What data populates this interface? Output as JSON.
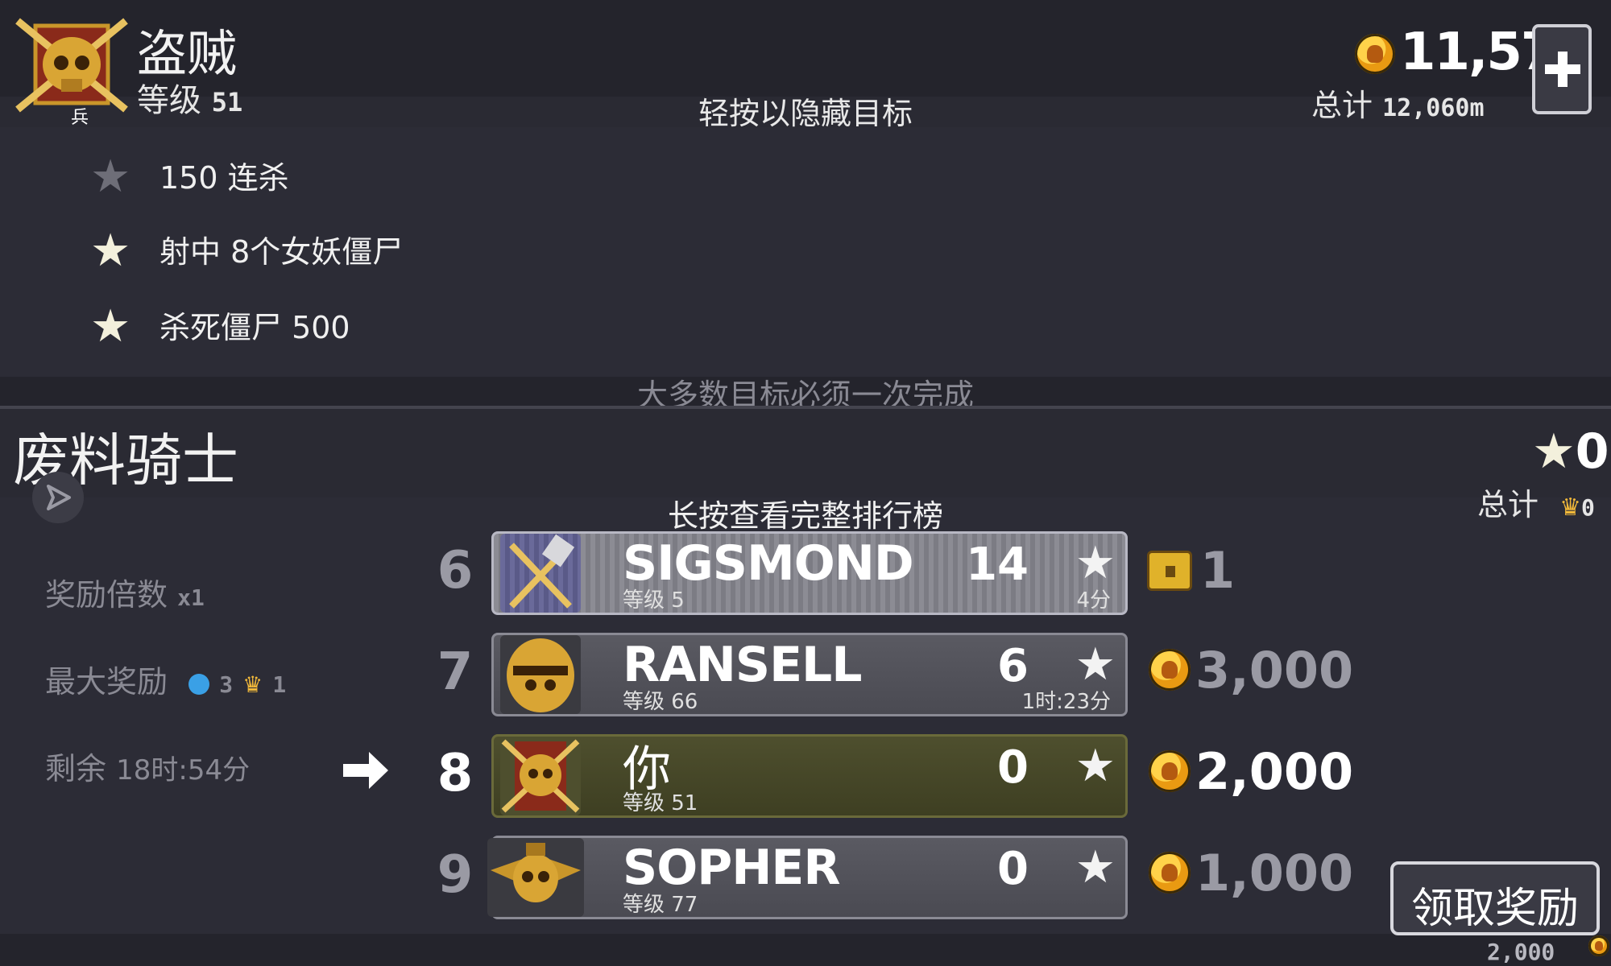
{
  "header": {
    "title": "盗贼",
    "level_label": "等级",
    "level_value": "51",
    "badge_text": "兵",
    "coins": "11,570",
    "total_label": "总计",
    "total_distance": "12,060m",
    "hint": "轻按以隐藏目标"
  },
  "goals": [
    {
      "text": "150 连杀",
      "done": false
    },
    {
      "text": "射中 8个女妖僵尸",
      "done": true
    },
    {
      "text": "杀死僵尸 500",
      "done": true
    }
  ],
  "goals_footer": "大多数目标必须一次完成",
  "event": {
    "title": "废料骑士",
    "stars": "0",
    "total_label": "总计",
    "total_crowns": "0",
    "hint": "长按查看完整排行榜"
  },
  "info": {
    "multiplier_label": "奖励倍数",
    "multiplier_value": "x1",
    "max_reward_label": "最大奖励",
    "max_reward_gems": "3",
    "max_reward_crowns": "1",
    "remaining_label": "剩余",
    "remaining_value": "18时:54分"
  },
  "leaderboard": [
    {
      "rank": "6",
      "name": "SIGSMOND",
      "level": "等级 5",
      "stars": "14",
      "time": "4分",
      "reward": "1",
      "reward_type": "chest"
    },
    {
      "rank": "7",
      "name": "RANSELL",
      "level": "等级 66",
      "stars": "6",
      "time": "1时:23分",
      "reward": "3,000",
      "reward_type": "coin"
    },
    {
      "rank": "8",
      "name": "你",
      "level": "等级 51",
      "stars": "0",
      "time": "",
      "reward": "2,000",
      "reward_type": "coin"
    },
    {
      "rank": "9",
      "name": "SOPHER",
      "level": "等级 77",
      "stars": "0",
      "time": "",
      "reward": "1,000",
      "reward_type": "coin"
    }
  ],
  "claim": {
    "label": "领取奖励",
    "amount": "2,000"
  },
  "colors": {
    "background": "#2c2c36",
    "band": "#24242c",
    "gold": "#f2b93a",
    "muted": "#8a8a94"
  }
}
